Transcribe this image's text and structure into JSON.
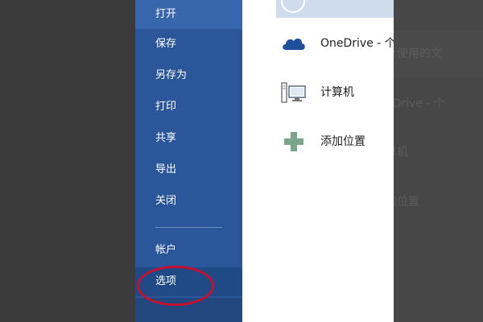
{
  "sidebar": {
    "items": [
      {
        "label": "打开"
      },
      {
        "label": "保存"
      },
      {
        "label": "另存为"
      },
      {
        "label": "打印"
      },
      {
        "label": "共享"
      },
      {
        "label": "导出"
      },
      {
        "label": "关闭"
      },
      {
        "label": "帐户"
      },
      {
        "label": "选项",
        "selected": true
      }
    ]
  },
  "places": [
    {
      "label": "OneDrive - 个",
      "icon": "cloud-icon"
    },
    {
      "label": "计算机",
      "icon": "computer-icon"
    },
    {
      "label": "添加位置",
      "icon": "plus-icon"
    }
  ],
  "background_ghost": [
    {
      "text": "近使用的文"
    },
    {
      "text": "eDrive - 个"
    },
    {
      "text": "算机"
    },
    {
      "text": "加位置"
    }
  ],
  "colors": {
    "sidebar": "#2b579a",
    "sidebar_selected": "#204a86",
    "highlight_annotation": "#c8102e",
    "onedrive_icon": "#1e4e9c",
    "add_icon": "#7aa58b"
  }
}
